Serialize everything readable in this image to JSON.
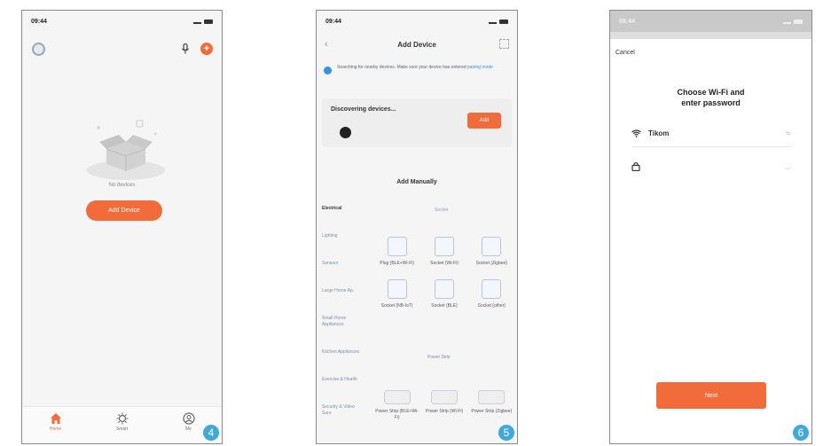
{
  "colors": {
    "accent": "#f26b3a",
    "badge": "#3fa9d8",
    "link": "#3c8ee8"
  },
  "screens": [
    {
      "step": "4",
      "status": {
        "time": "09:44"
      },
      "empty_state": {
        "message": "No devices",
        "add_button": "Add Device"
      },
      "tabs": [
        {
          "label": "Home",
          "icon": "home-icon"
        },
        {
          "label": "Smart",
          "icon": "smart-icon"
        },
        {
          "label": "Me",
          "icon": "profile-icon"
        }
      ]
    },
    {
      "step": "5",
      "status": {
        "time": "09:44"
      },
      "title": "Add Device",
      "notice": {
        "text": "Searching for nearby devices. Make sure your device has entered",
        "link": "pairing mode"
      },
      "discover": {
        "title": "Discovering devices...",
        "button": "Add"
      },
      "manual_title": "Add Manually",
      "categories": [
        "Electrical",
        "Lighting",
        "Sensors",
        "Large Home Ap.",
        "Small Home Appliances",
        "Kitchen Appliances",
        "Exercise & Health",
        "Security & Video Surv."
      ],
      "subcategory": "Socket",
      "devices": [
        {
          "label": "Plug (BLE+Wi-Fi)"
        },
        {
          "label": "Socket (Wi-Fi)"
        },
        {
          "label": "Socket (Zigbee)"
        },
        {
          "label": "Socket (NB-IoT)"
        },
        {
          "label": "Socket (BLE)"
        },
        {
          "label": "Socket (other)"
        }
      ],
      "group_label": "Power Strip",
      "devices2": [
        {
          "label": "Power Strip (BLE+Wi-Fi)"
        },
        {
          "label": "Power Strip (Wi-Fi)"
        },
        {
          "label": "Power Strip (Zigbee)"
        }
      ]
    },
    {
      "step": "6",
      "status": {
        "time": "09:44"
      },
      "cancel": "Cancel",
      "title_line1": "Choose Wi-Fi and",
      "title_line2": "enter password",
      "wifi": {
        "ssid": "Tikom",
        "change": "⇆"
      },
      "password": {
        "value": "",
        "placeholder": ""
      },
      "next_button": "Next"
    }
  ]
}
